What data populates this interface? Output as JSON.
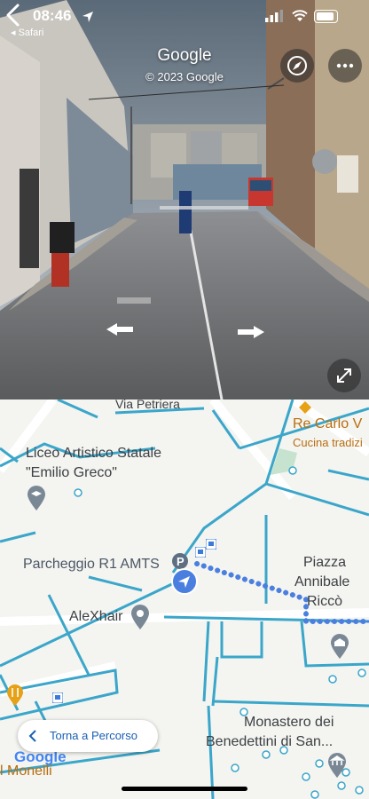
{
  "status_bar": {
    "time": "08:46",
    "back_app": "◂ Safari"
  },
  "header": {
    "title": "Google",
    "copyright": "© 2023 Google"
  },
  "icons": {
    "back": "chevron-left-icon",
    "compass": "compass-icon",
    "more": "more-dots-icon",
    "expand": "expand-icon",
    "location": "location-arrow-icon"
  },
  "map": {
    "labels": {
      "street_top": "Via Petriera",
      "poi_re_carlo": "Re Carlo V",
      "poi_re_carlo_sub": "Cucina tradizi",
      "liceo_line1": "Liceo Artistico Statale",
      "liceo_line2": "\"Emilio Greco\"",
      "parcheggio": "Parcheggio R1 AMTS",
      "piazza_line1": "Piazza",
      "piazza_line2": "Annibale",
      "piazza_line3": "Riccò",
      "alexhair": "AleXhair",
      "monastero_line1": "Monastero dei",
      "monastero_line2": "Benedettini di San...",
      "monelli": "l Monelli",
      "google_logo": "Google"
    },
    "back_route_label": "Torna a Percorso"
  },
  "colors": {
    "route_blue": "#3aa6c9",
    "poi_orange": "#c07a12",
    "dot_blue": "#4a7fe0"
  }
}
